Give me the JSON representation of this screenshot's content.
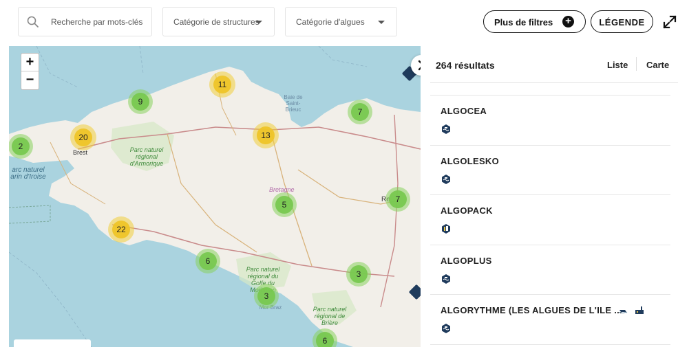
{
  "filters": {
    "search_placeholder": "Recherche par mots-clés",
    "structure_category": "Catégorie de structures",
    "algae_category": "Catégorie d'algues",
    "more_filters": "Plus de filtres",
    "legend": "LÉGENDE"
  },
  "map": {
    "zoom_in": "+",
    "zoom_out": "−",
    "labels": {
      "brest": "Brest",
      "bretagne": "Bretagne",
      "rennes": "Re",
      "baie": "Baie de Saint-Brieuc",
      "armorique": "Parc naturel régional d'Armorique",
      "iroise": "arc naturel arin d'Iroise",
      "golfe": "Parc naturel régional du Golfe du Morbihan",
      "mer_broz": "Mor Braz",
      "briere": "Parc naturel régional de Brière"
    },
    "clusters": [
      {
        "count": "11",
        "level": "yellow"
      },
      {
        "count": "9",
        "level": "green"
      },
      {
        "count": "7",
        "level": "green"
      },
      {
        "count": "20",
        "level": "yellow"
      },
      {
        "count": "2",
        "level": "green"
      },
      {
        "count": "13",
        "level": "yellow"
      },
      {
        "count": "5",
        "level": "green"
      },
      {
        "count": "7",
        "level": "green"
      },
      {
        "count": "22",
        "level": "yellow"
      },
      {
        "count": "6",
        "level": "green"
      },
      {
        "count": "3",
        "level": "green"
      },
      {
        "count": "3",
        "level": "green"
      },
      {
        "count": "6",
        "level": "green"
      }
    ]
  },
  "results": {
    "count": "264 résultats",
    "view_list": "Liste",
    "view_map": "Carte",
    "items": [
      {
        "name": "ALGOCEA",
        "icon": "seaweed-harvest-icon"
      },
      {
        "name": "ALGOLESKO",
        "icon": "seaweed-harvest-icon"
      },
      {
        "name": "ALGOPACK",
        "icon": "processing-icon"
      },
      {
        "name": "ALGOPLUS",
        "icon": "seaweed-harvest-icon"
      },
      {
        "name": "ALGORYTHME (LES ALGUES DE L'ILE ...",
        "icon": "seaweed-harvest-icon"
      }
    ]
  },
  "colors": {
    "sea": "#aad3df",
    "land": "#f2efe9",
    "cluster_green": "#78c850",
    "cluster_yellow": "#eec428",
    "marker": "#1f3b5c"
  }
}
